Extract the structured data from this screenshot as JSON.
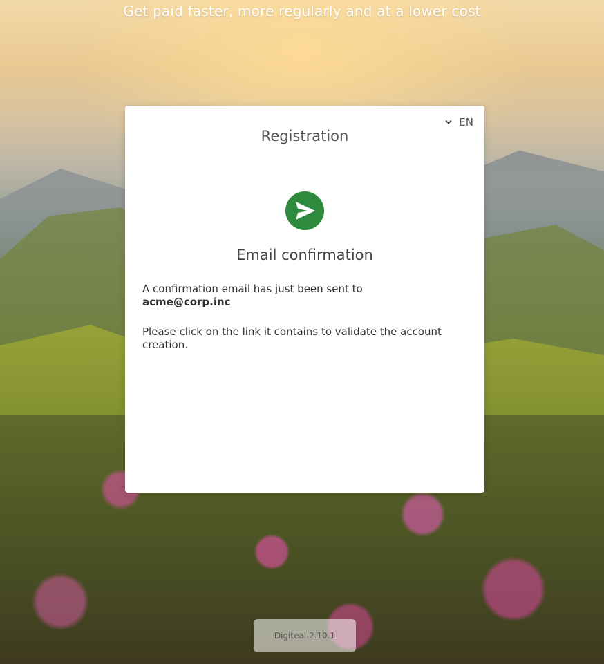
{
  "header": {
    "tagline": "Get paid faster, more regularly and at a lower cost"
  },
  "card": {
    "title": "Registration",
    "language": {
      "selected": "EN",
      "icon": "chevron-down-icon"
    },
    "icon": "send-icon",
    "icon_color": "#2e8b3e",
    "section_title": "Email confirmation",
    "message_intro": "A confirmation email has just been sent to",
    "email": "acme@corp.inc",
    "message_instructions": "Please click on the link it contains to validate the account creation."
  },
  "footer": {
    "version": "Digiteal 2.10.1"
  }
}
